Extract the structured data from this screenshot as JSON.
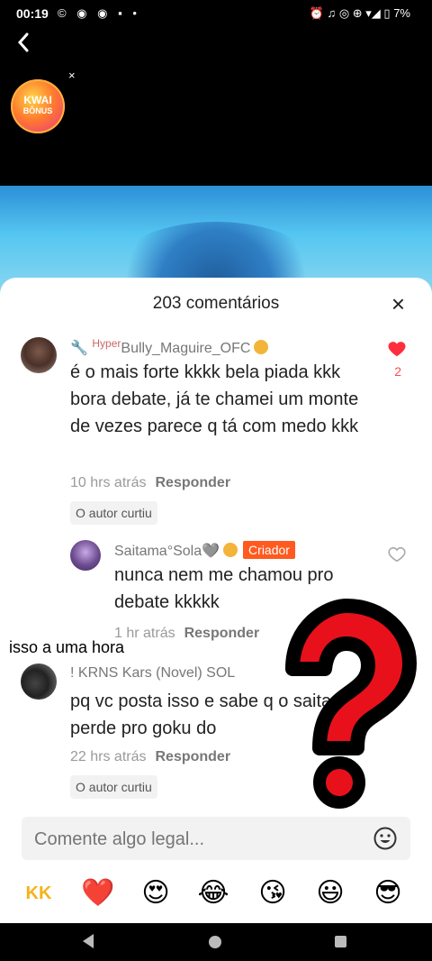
{
  "status_bar": {
    "time": "00:19",
    "left_icons": "© ◉ ◉ ▪ •",
    "battery": "7%",
    "right_icons": "⏰ ♫ ◎ ⊕ ▾◢ ▯"
  },
  "top": {
    "kwai_line1": "KWAI",
    "kwai_line2": "BÔNUS",
    "kwai_close": "×"
  },
  "sheet": {
    "title": "203 comentários",
    "close": "×"
  },
  "comments": [
    {
      "username": "Bully_Maguire_OFC",
      "username_prefix": "🔧 ",
      "username_super": "Hyper",
      "text": "é o mais forte kkkk bela piada kkk bora debate, já te chamei um monte de vezes parece q tá com medo kkk",
      "time": "10 hrs atrás",
      "reply": "Responder",
      "liked_chip": "O autor curtiu",
      "like_count": "2"
    },
    {
      "username": "Saitama°Sola🩶",
      "creator": "Criador",
      "text": "nunca nem me chamou pro debate kkkkk",
      "time": "1 hr atrás",
      "reply": "Responder"
    },
    {
      "username": "! KRNS Kars (Novel) SOL",
      "text": "pq vc posta isso e sabe q o saitama perde pro goku do",
      "time": "22 hrs atrás",
      "reply": "Responder",
      "liked_chip": "O autor curtiu"
    }
  ],
  "overlay_caption": "isso a uma hora",
  "input": {
    "placeholder": "Comente algo legal..."
  },
  "emojis": [
    "KK",
    "❤️",
    "😍",
    "😂",
    "😘",
    "😃",
    "😎"
  ]
}
